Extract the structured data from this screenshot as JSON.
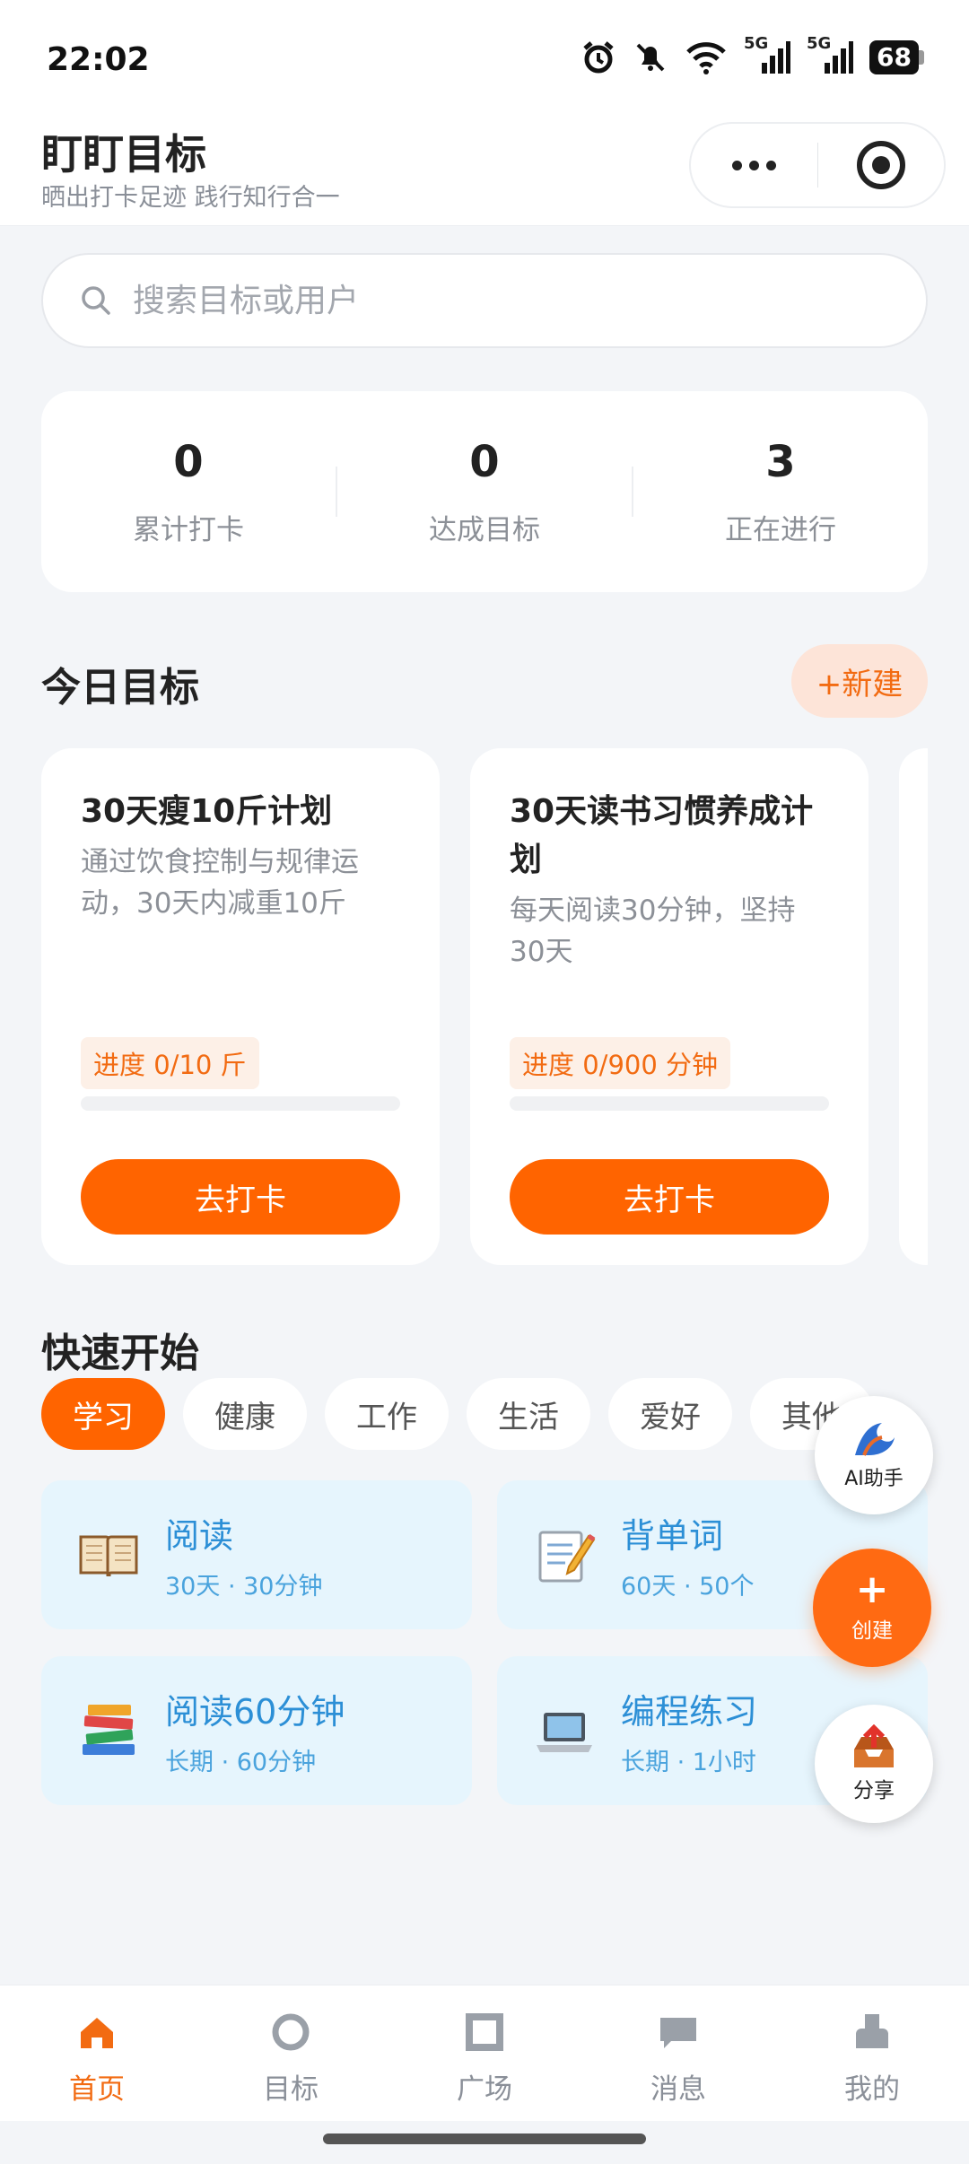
{
  "status_bar": {
    "time": "22:02",
    "battery": "68",
    "network_1": "5G",
    "network_2": "5G",
    "icons": [
      "alarm-icon",
      "mute-bell-icon",
      "wifi-icon",
      "signal-icon",
      "signal-icon",
      "battery-icon"
    ]
  },
  "header": {
    "title": "盯盯目标",
    "subtitle": "晒出打卡足迹 践行知行合一"
  },
  "search": {
    "placeholder": "搜索目标或用户"
  },
  "stats": [
    {
      "value": "0",
      "label": "累计打卡"
    },
    {
      "value": "0",
      "label": "达成目标"
    },
    {
      "value": "3",
      "label": "正在进行"
    }
  ],
  "today": {
    "title": "今日目标",
    "new_label": "+新建",
    "goals": [
      {
        "title": "30天瘦10斤计划",
        "desc": "通过饮食控制与规律运动，30天内减重10斤",
        "progress_label": "进度 0/10 斤",
        "progress": 0,
        "button": "去打卡"
      },
      {
        "title": "30天读书习惯养成计划",
        "desc": "每天阅读30分钟，坚持30天",
        "progress_label": "进度 0/900 分钟",
        "progress": 0,
        "button": "去打卡"
      }
    ]
  },
  "quick": {
    "title": "快速开始",
    "categories": [
      "学习",
      "健康",
      "工作",
      "生活",
      "爱好",
      "其他"
    ],
    "active_category": "学习",
    "templates": [
      {
        "icon": "book-icon",
        "title": "阅读",
        "meta": "30天 · 30分钟"
      },
      {
        "icon": "memo-icon",
        "title": "背单词",
        "meta": "60天 · 50个"
      },
      {
        "icon": "books-icon",
        "title": "阅读60分钟",
        "meta": "长期 · 60分钟"
      },
      {
        "icon": "laptop-icon",
        "title": "编程练习",
        "meta": "长期 · 1小时"
      }
    ]
  },
  "fabs": {
    "ai_label": "AI助手",
    "create_plus": "+",
    "create_label": "创建",
    "share_label": "分享"
  },
  "tabbar": {
    "items": [
      {
        "label": "首页",
        "icon": "home-icon",
        "active": true
      },
      {
        "label": "目标",
        "icon": "target-icon",
        "active": false
      },
      {
        "label": "广场",
        "icon": "square-icon",
        "active": false
      },
      {
        "label": "消息",
        "icon": "message-icon",
        "active": false
      },
      {
        "label": "我的",
        "icon": "profile-icon",
        "active": false
      }
    ]
  },
  "colors": {
    "accent": "#ff6400",
    "accent_text": "#f26b12",
    "template_bg": "#e6f5fd",
    "template_text": "#2c8fd6",
    "page_bg": "#f3f5f8"
  }
}
